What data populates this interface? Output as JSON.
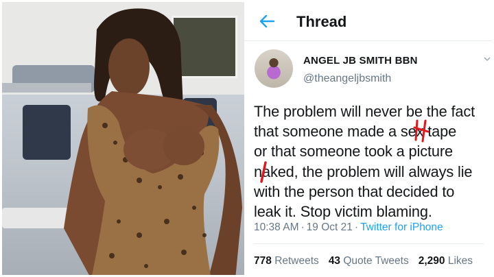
{
  "header": {
    "back_icon": "arrow-left-icon",
    "title": "Thread"
  },
  "tweet": {
    "display_name": "ANGEL JB SMITH BBN",
    "handle": "@theangeljbsmith",
    "text_lines": [
      "The problem will never be the fact",
      "that someone made a sex tape",
      "or that someone took a picture",
      "naked, the problem will always lie",
      "with the person that decided to",
      "leak it. Stop victim blaming."
    ],
    "time": "10:38 AM",
    "date": "19 Oct 21",
    "source": "Twitter for iPhone"
  },
  "stats": {
    "retweets_count": "778",
    "retweets_label": "Retweets",
    "quote_count": "43",
    "quote_label": "Quote Tweets",
    "likes_count": "2,290",
    "likes_label": "Likes"
  },
  "colors": {
    "accent": "#1da1f2",
    "text": "#14171a",
    "muted": "#657786",
    "annotation_red": "#e0181c"
  }
}
